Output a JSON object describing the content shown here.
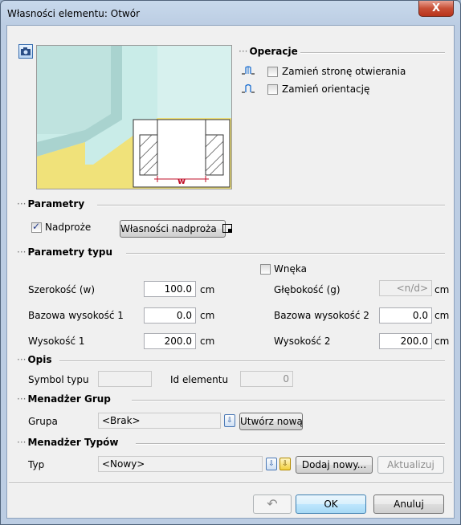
{
  "window": {
    "title": "Własności elementu: Otwór",
    "close_glyph": "X"
  },
  "preview": {
    "dimension_label": "w"
  },
  "operations": {
    "header": "Operacje",
    "swap_side": {
      "label": "Zamień stronę otwierania",
      "checked": false
    },
    "swap_orientation": {
      "label": "Zamień orientację",
      "checked": false
    }
  },
  "parameters": {
    "header": "Parametry",
    "lintel": {
      "label": "Nadproże",
      "checked": true
    },
    "lintel_props_button": "Własności nadproża"
  },
  "type_parameters": {
    "header": "Parametry typu",
    "niche": {
      "label": "Wnęka",
      "checked": false
    },
    "width": {
      "label": "Szerokość (w)",
      "value": "100.0",
      "unit": "cm"
    },
    "depth": {
      "label": "Głębokość (g)",
      "value": "<n/d>",
      "unit": "cm"
    },
    "base_height_1": {
      "label": "Bazowa wysokość 1",
      "value": "0.0",
      "unit": "cm"
    },
    "base_height_2": {
      "label": "Bazowa wysokość 2",
      "value": "0.0",
      "unit": "cm"
    },
    "height_1": {
      "label": "Wysokość 1",
      "value": "200.0",
      "unit": "cm"
    },
    "height_2": {
      "label": "Wysokość 2",
      "value": "200.0",
      "unit": "cm"
    }
  },
  "description": {
    "header": "Opis",
    "type_symbol": {
      "label": "Symbol typu",
      "value": ""
    },
    "element_id": {
      "label": "Id elementu",
      "value": "0"
    }
  },
  "group_manager": {
    "header": "Menadżer Grup",
    "group_label": "Grupa",
    "group_value": "<Brak>",
    "create_new": "Utwórz nową"
  },
  "type_manager": {
    "header": "Menadżer Typów",
    "type_label": "Typ",
    "type_value": "<Nowy>",
    "add_new": "Dodaj nowy...",
    "update": "Aktualizuj"
  },
  "footer": {
    "undo_glyph": "↶",
    "ok": "OK",
    "cancel": "Anuluj"
  },
  "colors": {
    "accent_blue": "#3c7fb1",
    "floor_yellow": "#f0e27a",
    "wall_cyan": "#c9ece8",
    "dimension_red": "#c0122b"
  }
}
